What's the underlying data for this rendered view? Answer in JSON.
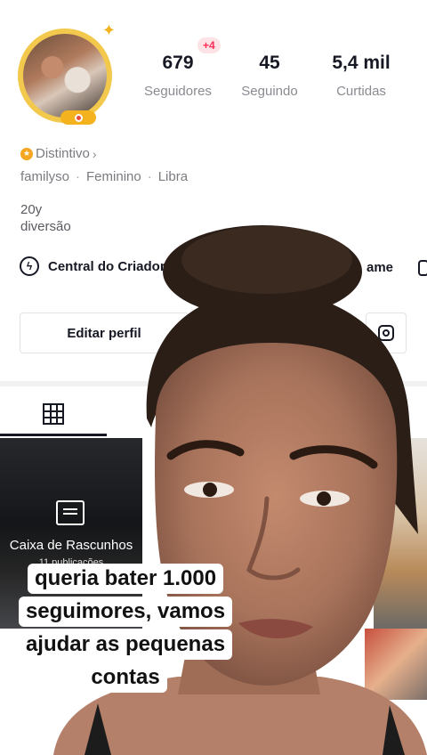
{
  "profile": {
    "new_followers_badge": "+4",
    "stats": [
      {
        "value": "679",
        "label": "Seguidores"
      },
      {
        "value": "45",
        "label": "Seguindo"
      },
      {
        "value": "5,4 mil",
        "label": "Curtidas"
      }
    ],
    "badge_label": "Distintivo",
    "meta": [
      "familyso",
      "Feminino",
      "Libra"
    ],
    "bio": [
      "20y",
      "diversão"
    ],
    "creator_center": "Central do Criador",
    "game_label": "ame",
    "edit_profile": "Editar perfil"
  },
  "grid": {
    "drafts_title": "Caixa de Rascunhos",
    "drafts_count": "11 publicações"
  },
  "caption": {
    "lines": [
      "queria bater 1.000",
      "seguimores, vamos",
      "ajudar as pequenas",
      "contas"
    ]
  },
  "colors": {
    "accent": "#fe2c55",
    "text": "#161823",
    "muted": "#8a8b91",
    "avatar_ring": "#f2c94c"
  },
  "icons": [
    "grid-icon",
    "instagram-icon",
    "creator-center-icon",
    "inbox-icon",
    "chevron-right-icon",
    "badge-icon"
  ]
}
